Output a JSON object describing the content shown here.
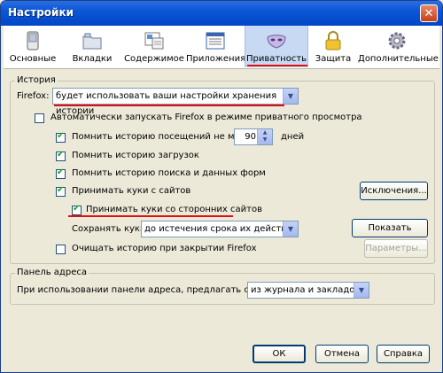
{
  "window": {
    "title": "Настройки",
    "close_label": "✕"
  },
  "tabs": [
    {
      "label": "Основные"
    },
    {
      "label": "Вкладки"
    },
    {
      "label": "Содержимое"
    },
    {
      "label": "Приложения"
    },
    {
      "label": "Приватность"
    },
    {
      "label": "Защита"
    },
    {
      "label": "Дополнительные"
    }
  ],
  "active_tab": "Приватность",
  "history": {
    "group_label": "История",
    "firefox_label": "Firefox:",
    "firefox_select": "будет использовать ваши настройки хранения истории",
    "auto_private_label": "Автоматически запускать Firefox в режиме приватного просмотра",
    "auto_private_checked": false,
    "remember_visits_label": "Помнить историю посещений не менее",
    "remember_visits_checked": true,
    "days_value": "90",
    "days_unit": "дней",
    "remember_downloads_label": "Помнить историю загрузок",
    "remember_downloads_checked": true,
    "remember_search_label": "Помнить историю поиска и данных форм",
    "remember_search_checked": true,
    "accept_cookies_label": "Принимать куки с сайтов",
    "accept_cookies_checked": true,
    "exceptions_button": "Исключения...",
    "third_party_label": "Принимать куки со сторонних сайтов",
    "third_party_checked": true,
    "keep_cookies_label": "Сохранять куки:",
    "keep_cookies_select": "до истечения срока их действия",
    "show_cookies_button": "Показать куки...",
    "clear_on_close_label": "Очищать историю при закрытии Firefox",
    "clear_on_close_checked": false,
    "params_button": "Параметры..."
  },
  "addressbar": {
    "group_label": "Панель адреса",
    "suggest_label": "При использовании панели адреса, предлагать ссылки:",
    "suggest_select": "из журнала и закладок"
  },
  "footer": {
    "ok": "ОК",
    "cancel": "Отмена",
    "help": "Справка"
  },
  "colors": {
    "highlight_red": "#e01010",
    "active_tab_bg": "#c8d9f4",
    "title_blue": "#0b56d8"
  }
}
